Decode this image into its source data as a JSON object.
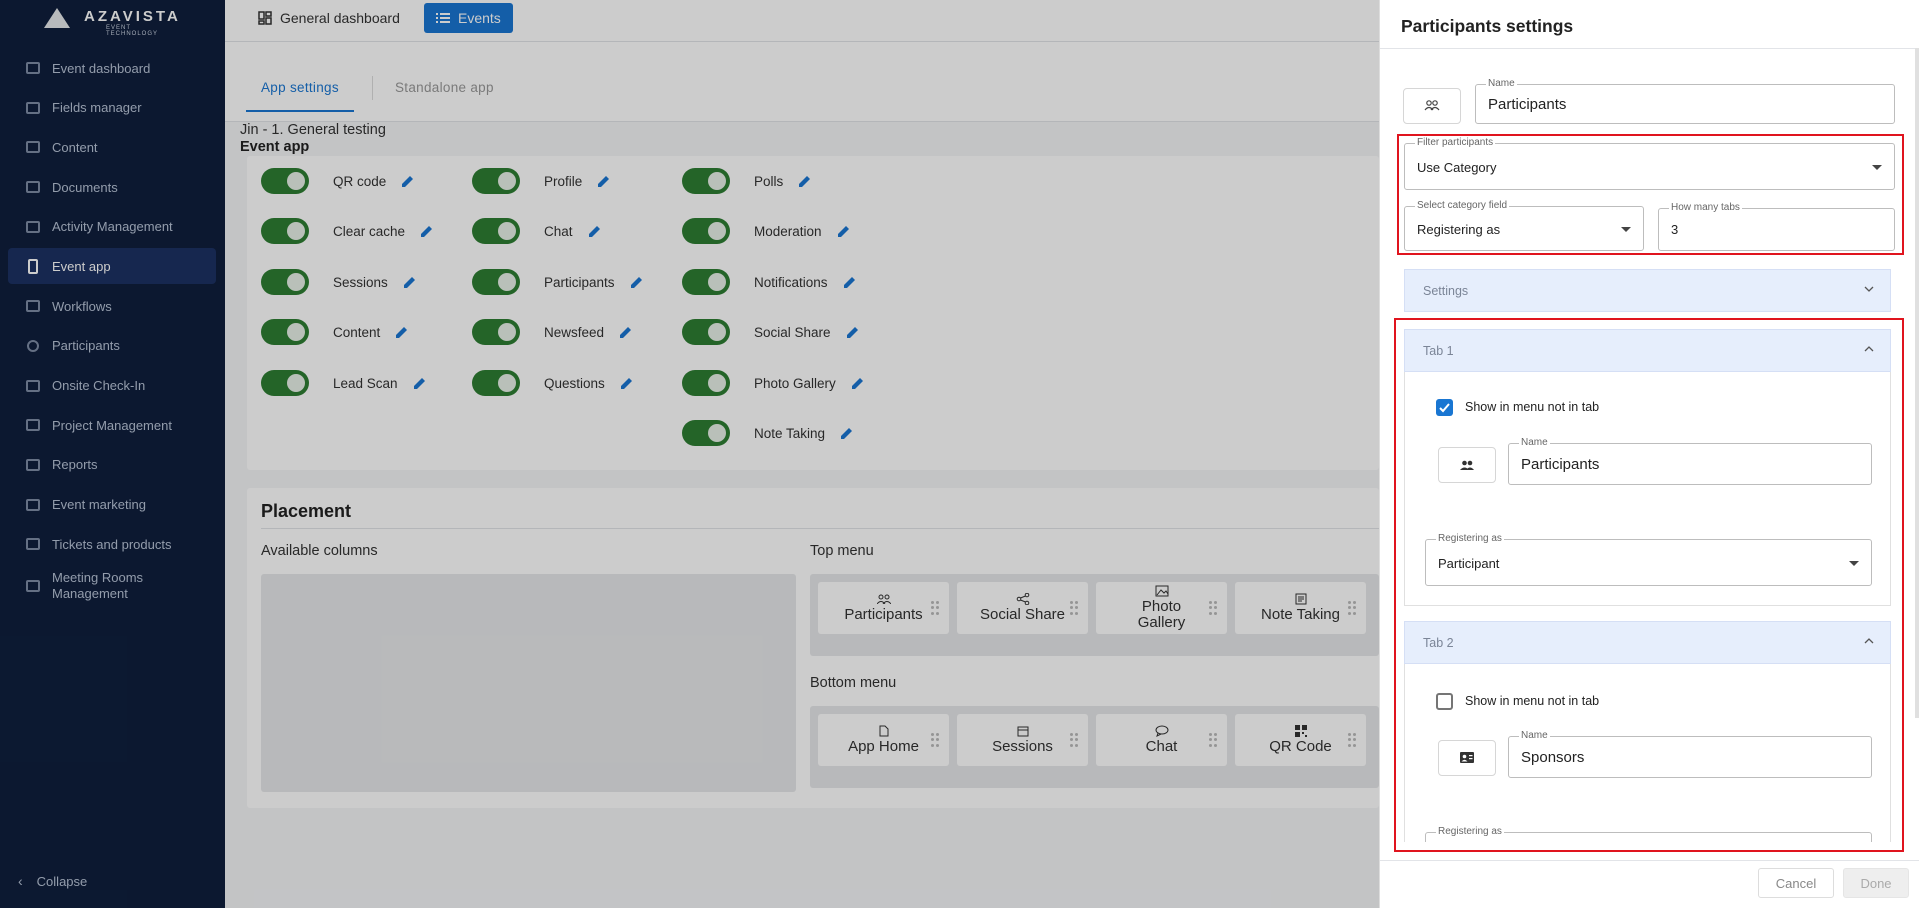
{
  "brand": {
    "name": "AZAVISTA",
    "tagline": "EVENT TECHNOLOGY"
  },
  "sidebar": {
    "items": [
      {
        "label": "Event dashboard",
        "icon": "dashboard-icon"
      },
      {
        "label": "Fields manager",
        "icon": "fields-icon"
      },
      {
        "label": "Content",
        "icon": "content-icon"
      },
      {
        "label": "Documents",
        "icon": "document-icon"
      },
      {
        "label": "Activity Management",
        "icon": "calendar-icon"
      },
      {
        "label": "Event app",
        "icon": "phone-icon",
        "active": true
      },
      {
        "label": "Workflows",
        "icon": "workflow-icon"
      },
      {
        "label": "Participants",
        "icon": "person-icon"
      },
      {
        "label": "Onsite Check-In",
        "icon": "mail-icon"
      },
      {
        "label": "Project Management",
        "icon": "project-icon"
      },
      {
        "label": "Reports",
        "icon": "reports-icon"
      },
      {
        "label": "Event marketing",
        "icon": "marketing-icon"
      },
      {
        "label": "Tickets and products",
        "icon": "ticket-icon"
      },
      {
        "label": "Meeting Rooms Management",
        "icon": "meeting-room-icon"
      }
    ],
    "collapse_label": "Collapse"
  },
  "topbar": {
    "dashboard_label": "General dashboard",
    "events_label": "Events"
  },
  "tabs": {
    "app_settings": "App settings",
    "standalone_app": "Standalone app"
  },
  "event": {
    "name": "Jin - 1. General testing",
    "section": "Event app"
  },
  "features": {
    "col1": [
      "QR code",
      "Clear cache",
      "Sessions",
      "Content",
      "Lead Scan"
    ],
    "col2": [
      "Profile",
      "Chat",
      "Participants",
      "Newsfeed",
      "Questions"
    ],
    "col3": [
      "Polls",
      "Moderation",
      "Notifications",
      "Social Share",
      "Photo Gallery",
      "Note Taking"
    ]
  },
  "placement": {
    "title": "Placement",
    "available_label": "Available columns",
    "top_menu_label": "Top menu",
    "bottom_menu_label": "Bottom menu",
    "top_menu": [
      "Participants",
      "Social Share",
      "Photo Gallery",
      "Note Taking"
    ],
    "bottom_menu": [
      "App Home",
      "Sessions",
      "Chat",
      "QR Code"
    ]
  },
  "panel": {
    "title": "Participants settings",
    "name_label": "Name",
    "name_value": "Participants",
    "filter_label": "Filter participants",
    "filter_value": "Use Category",
    "category_label": "Select category field",
    "category_value": "Registering as",
    "tabs_count_label": "How many tabs",
    "tabs_count_value": "3",
    "settings_label": "Settings",
    "tab1": {
      "title": "Tab 1",
      "checkbox_label": "Show in menu not in tab",
      "checked": true,
      "name_label": "Name",
      "name_value": "Participants",
      "reg_label": "Registering as",
      "reg_value": "Participant"
    },
    "tab2": {
      "title": "Tab 2",
      "checkbox_label": "Show in menu not in tab",
      "checked": false,
      "name_label": "Name",
      "name_value": "Sponsors",
      "reg_label": "Registering as"
    },
    "cancel_label": "Cancel",
    "done_label": "Done"
  },
  "colors": {
    "accent": "#1976d2",
    "sidebar": "#0f1f3d",
    "toggle_on": "#2e7d32",
    "highlight": "#e0141e"
  }
}
